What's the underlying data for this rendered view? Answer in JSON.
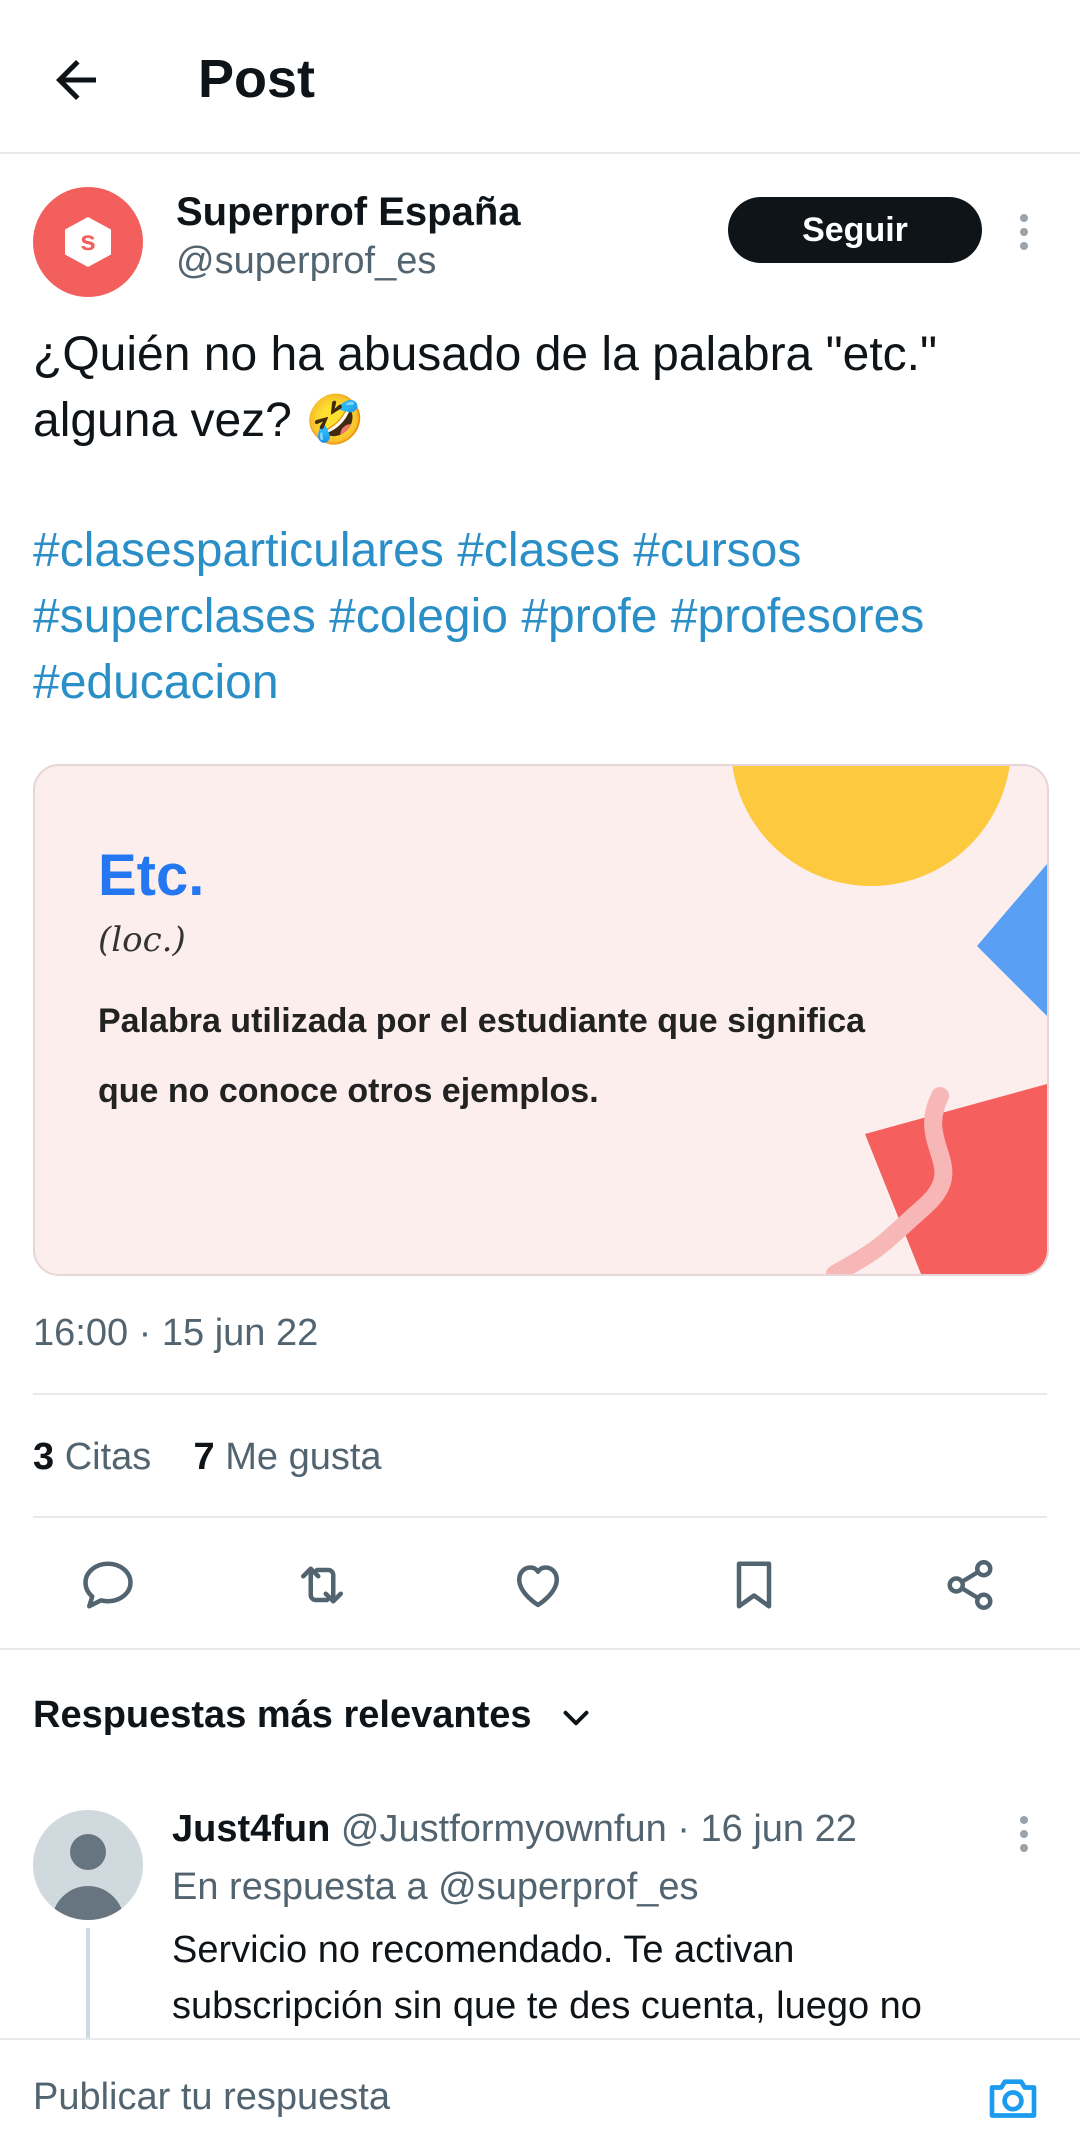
{
  "header": {
    "title": "Post"
  },
  "post": {
    "author_name": "Superprof España",
    "author_handle": "@superprof_es",
    "avatar_letter": "s",
    "follow_label": "Seguir",
    "text_line1": "¿Quién no ha abusado de la palabra \"etc.\"",
    "text_line2": "alguna vez? 🤣",
    "hashtags": [
      "#clasesparticulares",
      "#clases",
      "#cursos",
      "#superclases",
      "#colegio",
      "#profe",
      "#profesores",
      "#educacion"
    ],
    "card": {
      "word": "Etc.",
      "category": "(loc.)",
      "definition": "Palabra utilizada por el estudiante que significa que no conoce otros ejemplos."
    },
    "timestamp": "16:00 · 15 jun 22",
    "quotes_count": "3",
    "quotes_label": "Citas",
    "likes_count": "7",
    "likes_label": "Me gusta"
  },
  "actions": [
    "reply-icon",
    "repost-icon",
    "like-icon",
    "bookmark-icon",
    "share-icon"
  ],
  "replies": {
    "sort_label": "Respuestas más relevantes",
    "items": [
      {
        "name": "Just4fun",
        "handle": "@Justformyownfun",
        "date": "· 16 jun 22",
        "reply_to": "En respuesta a @superprof_es",
        "text_line1": "Servicio no recomendado. Te activan",
        "text_line2": "subscripción sin que te des cuenta, luego no"
      }
    ]
  },
  "composer": {
    "placeholder": "Publicar tu respuesta"
  },
  "colors": {
    "accent": "#1d9bf0",
    "brand": "#f25f5c",
    "text": "#0f1419",
    "muted": "#536471"
  }
}
